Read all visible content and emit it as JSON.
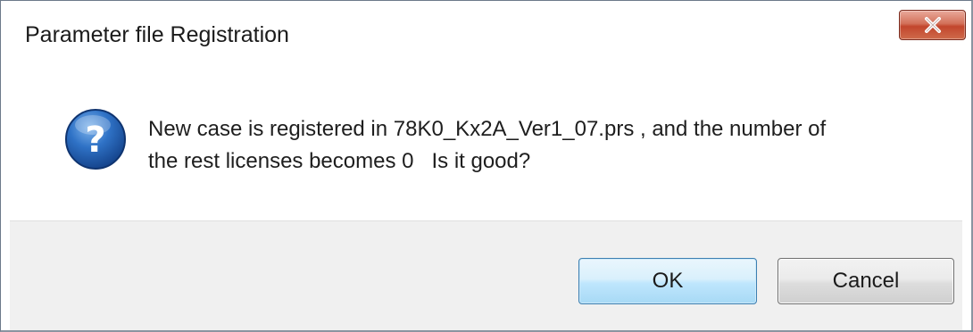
{
  "dialog": {
    "title": "Parameter file Registration",
    "close_icon": "close-icon",
    "message_icon": "question-icon",
    "message_line1": "New case is registered in 78K0_Kx2A_Ver1_07.prs , and the number of",
    "message_line2": "the rest licenses becomes 0   Is it good?",
    "buttons": {
      "ok_label": "OK",
      "cancel_label": "Cancel"
    }
  },
  "colors": {
    "close_button": "#c8503a",
    "icon_blue": "#1d5fb4",
    "ok_border": "#3c7fb1",
    "footer_bg": "#f0f0f0"
  }
}
